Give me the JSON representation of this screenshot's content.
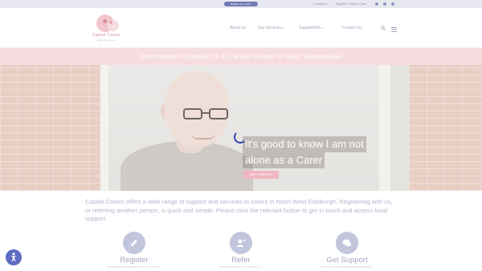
{
  "topbar": {
    "register_button": "Register as a Carer",
    "links": [
      "Contact us",
      "Register / Refer a Carer"
    ],
    "social_icons": [
      "twitter-icon",
      "facebook-icon",
      "instagram-icon"
    ]
  },
  "header": {
    "logo": {
      "line1": "Capital Carers",
      "line2": "Supporting Carers"
    },
    "nav": [
      {
        "label": "About us",
        "has_dropdown": false
      },
      {
        "label": "Our Services",
        "has_dropdown": true
      },
      {
        "label": "Support/Info",
        "has_dropdown": true
      },
      {
        "label": "Contact Us",
        "has_dropdown": false
      }
    ],
    "icons": [
      "search-icon",
      "menu-icon"
    ]
  },
  "banner": {
    "text": "SUPPORTING CARERS OF ALL AGES IN NORTH WEST EDINBURGH"
  },
  "hero": {
    "headline_line1": "It's good to know I am not",
    "headline_line2": "alone as a Carer",
    "button": "GET SUPPORT"
  },
  "intro": {
    "text": "Capital Carers offers a wide range of support and services to carers in North West Edinburgh. Registering with us, or referring another person, is quick and simple. Please click the relevant button to get in touch and access local support."
  },
  "cards": [
    {
      "title": "Register",
      "desc": "Are you an unsupported Carer? Tell us...",
      "icon": "pencil-icon"
    },
    {
      "title": "Refer",
      "desc": "Refer someone you care for or...",
      "icon": "add-user-icon"
    },
    {
      "title": "Get Support",
      "desc": "Contact us for immediate support and...",
      "icon": "chat-icon"
    }
  ],
  "colors": {
    "accent": "#6f7bb3",
    "pink": "#f7dde2",
    "spinner": "#3344aa"
  }
}
